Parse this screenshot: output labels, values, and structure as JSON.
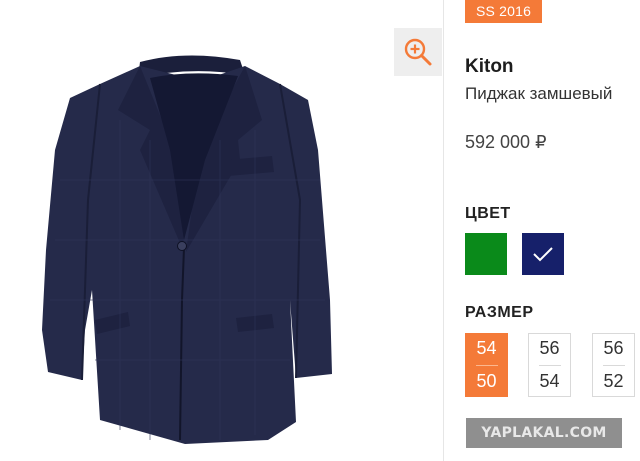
{
  "product": {
    "season": "SS 2016",
    "brand": "Kiton",
    "name": "Пиджак замшевый",
    "price": "592 000 ₽"
  },
  "zoom": {
    "icon": "zoom-in-icon"
  },
  "colors": {
    "label": "ЦВЕТ",
    "options": [
      {
        "name": "green",
        "hex": "#0a8a1a",
        "selected": false
      },
      {
        "name": "navy",
        "hex": "#16206a",
        "selected": true
      }
    ]
  },
  "sizes": {
    "label": "РАЗМЕР",
    "options": [
      {
        "top": "54",
        "bottom": "50",
        "selected": true
      },
      {
        "top": "56",
        "bottom": "54",
        "selected": false
      },
      {
        "top": "56",
        "bottom": "52",
        "selected": false
      }
    ]
  },
  "watermark": {
    "text": "YAPLAKAL.COM"
  },
  "theme": {
    "accent": "#f47a38",
    "jacket": "#252a4a"
  }
}
